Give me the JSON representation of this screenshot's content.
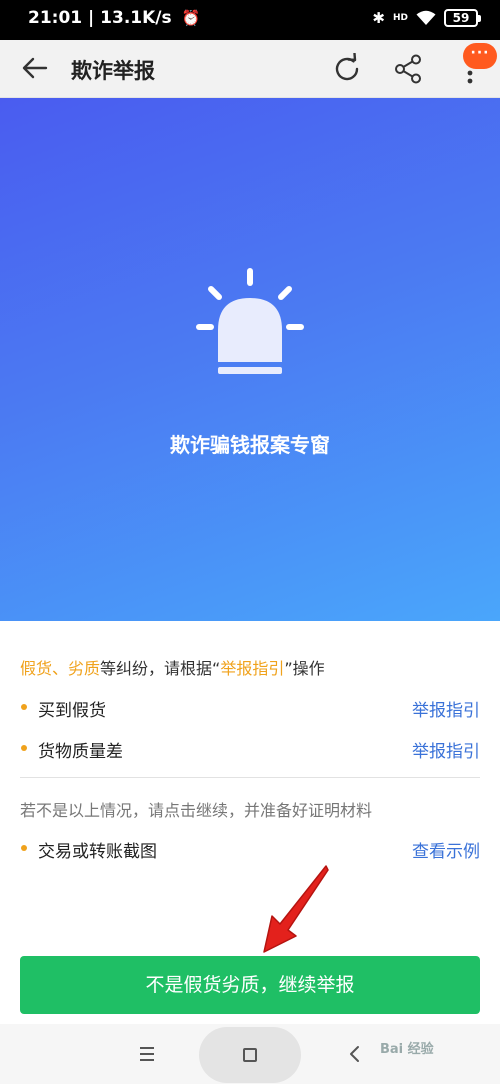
{
  "status_bar": {
    "time_speed": "21:01 | 13.1K/s",
    "alarm_icon": "alarm-clock-icon",
    "bluetooth_icon": "bluetooth-icon",
    "network_label": "HD",
    "wifi_icon": "wifi-icon",
    "battery": "59"
  },
  "app_bar": {
    "back_icon": "arrow-left-icon",
    "title": "欺诈举报",
    "refresh_icon": "refresh-icon",
    "share_icon": "share-icon",
    "more_icon": "more-vertical-icon",
    "badge": "···"
  },
  "hero": {
    "icon": "siren-alarm-icon",
    "title": "欺诈骗钱报案专窗",
    "gradient_colors": [
      "#4a5cf0",
      "#4aa6fb"
    ]
  },
  "notice": {
    "part1": "假货、劣质",
    "part2": "等纠纷，请根据“",
    "part3": "举报指引",
    "part4": "”操作"
  },
  "items": [
    {
      "label": "买到假货",
      "link": "举报指引"
    },
    {
      "label": "货物质量差",
      "link": "举报指引"
    }
  ],
  "hint": "若不是以上情况，请点击继续，并准备好证明材料",
  "evidence_item": {
    "label": "交易或转账截图",
    "link": "查看示例"
  },
  "continue_button": "不是假货劣质，继续举报",
  "nav_bar": {
    "menu_icon": "menu-lines-icon",
    "home_icon": "home-square-icon",
    "back_icon": "chevron-left-icon"
  },
  "watermark": "Bai 经验",
  "colors": {
    "accent_orange": "#f0a21c",
    "link_blue": "#3a72d8",
    "button_green": "#1fbf65",
    "badge_orange": "#ff5a1f"
  }
}
